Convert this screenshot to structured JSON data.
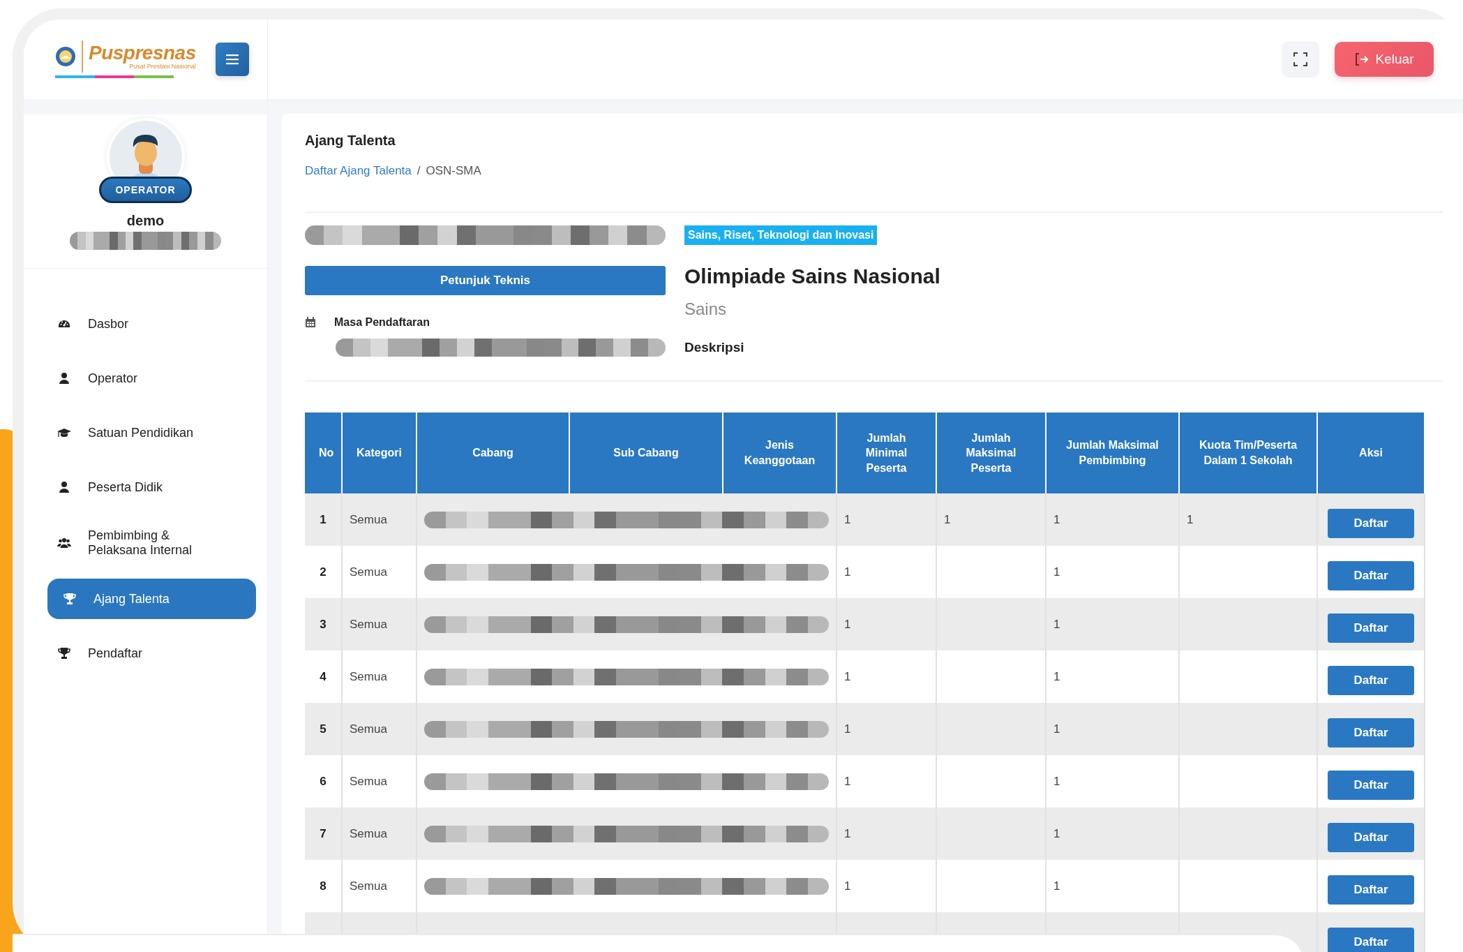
{
  "logo": {
    "name": "Puspresnas",
    "tagline": "Pusat Prestasi Nasional"
  },
  "profile": {
    "role": "OPERATOR",
    "username": "demo",
    "detail_redacted": true
  },
  "sidebar": {
    "items": [
      {
        "label": "Dasbor",
        "kind": "dashboard",
        "selected": false
      },
      {
        "label": "Operator",
        "kind": "user",
        "selected": false
      },
      {
        "label": "Satuan Pendidikan",
        "kind": "graduation",
        "selected": false
      },
      {
        "label": "Peserta Didik",
        "kind": "user",
        "selected": false
      },
      {
        "label": "Pembimbing & Pelaksana Internal",
        "kind": "users",
        "selected": false
      },
      {
        "label": "Ajang Talenta",
        "kind": "trophy",
        "selected": true
      },
      {
        "label": "Pendaftar",
        "kind": "trophy",
        "selected": false
      }
    ]
  },
  "topbar": {
    "logout": "Keluar"
  },
  "page": {
    "title": "Ajang Talenta",
    "breadcrumb": [
      {
        "label": "Daftar Ajang Talenta",
        "kind": "link"
      },
      {
        "label": "OSN-SMA",
        "kind": "current"
      }
    ],
    "separator": "/"
  },
  "event": {
    "banner_redacted": true,
    "guide_button": "Petunjuk Teknis",
    "period_label": "Masa Pendaftaran",
    "period_redacted": true,
    "tag": "Sains, Riset, Teknologi dan Inovasi",
    "name": "Olimpiade Sains Nasional",
    "field": "Sains",
    "description_label": "Deskripsi"
  },
  "table": {
    "columns": [
      "No",
      "Kategori",
      "Cabang",
      "Sub Cabang",
      "Jenis Keanggotaan",
      "Jumlah Minimal Peserta",
      "Jumlah Maksimal Peserta",
      "Jumlah Maksimal Pembimbing",
      "Kuota Tim/Peserta Dalam 1 Sekolah",
      "Aksi"
    ],
    "rows": [
      {
        "no": "1",
        "kategori": "Semua",
        "redacted": true,
        "min": "1",
        "maks": "1",
        "pembimbing": "1",
        "kuota": "1",
        "aksi": "Daftar"
      },
      {
        "no": "2",
        "kategori": "Semua",
        "redacted": true,
        "min": "1",
        "pembimbing": "1",
        "aksi": "Daftar"
      },
      {
        "no": "3",
        "kategori": "Semua",
        "redacted": true,
        "min": "1",
        "pembimbing": "1",
        "aksi": "Daftar"
      },
      {
        "no": "4",
        "kategori": "Semua",
        "redacted": true,
        "min": "1",
        "pembimbing": "1",
        "aksi": "Daftar"
      },
      {
        "no": "5",
        "kategori": "Semua",
        "redacted": true,
        "min": "1",
        "pembimbing": "1",
        "aksi": "Daftar"
      },
      {
        "no": "6",
        "kategori": "Semua",
        "redacted": true,
        "min": "1",
        "pembimbing": "1",
        "aksi": "Daftar"
      },
      {
        "no": "7",
        "kategori": "Semua",
        "redacted": true,
        "min": "1",
        "pembimbing": "1",
        "aksi": "Daftar"
      },
      {
        "no": "8",
        "kategori": "Semua",
        "redacted": true,
        "min": "1",
        "pembimbing": "1",
        "aksi": "Daftar"
      },
      {
        "aksi": "Daftar"
      }
    ]
  }
}
